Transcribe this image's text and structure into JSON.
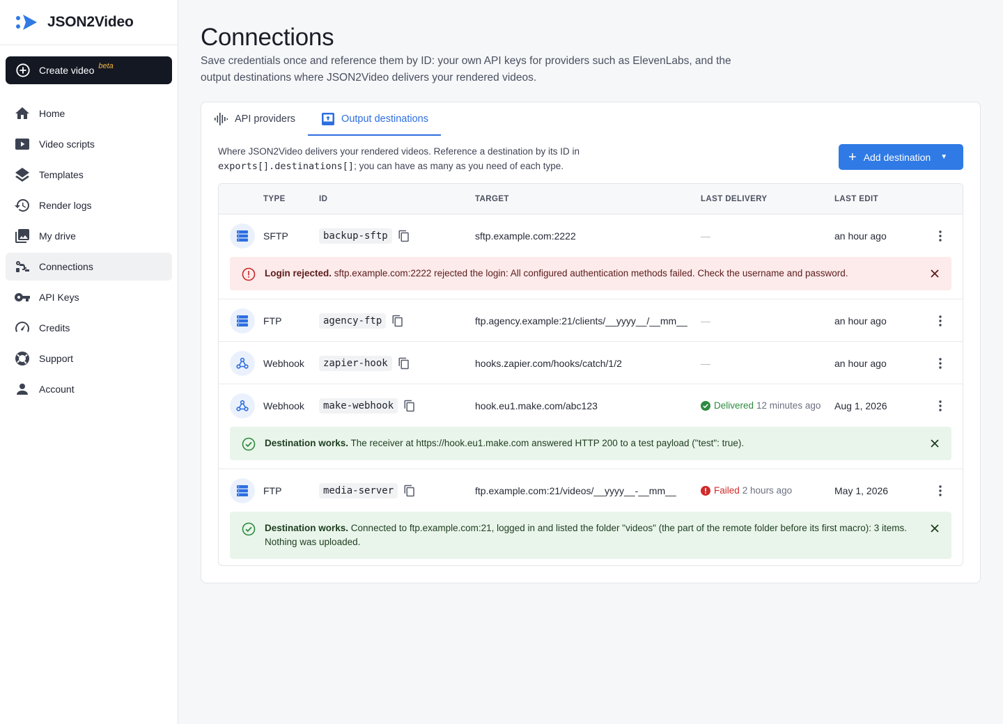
{
  "app": {
    "name": "JSON2Video"
  },
  "sidebar": {
    "create": {
      "label": "Create video",
      "badge": "beta"
    },
    "items": [
      {
        "label": "Home",
        "icon": "home-icon"
      },
      {
        "label": "Video scripts",
        "icon": "video-icon"
      },
      {
        "label": "Templates",
        "icon": "layers-icon"
      },
      {
        "label": "Render logs",
        "icon": "history-icon"
      },
      {
        "label": "My drive",
        "icon": "photo-library-icon"
      },
      {
        "label": "Connections",
        "icon": "connections-icon",
        "active": true
      },
      {
        "label": "API Keys",
        "icon": "key-icon"
      },
      {
        "label": "Credits",
        "icon": "gauge-icon"
      },
      {
        "label": "Support",
        "icon": "lifebuoy-icon"
      },
      {
        "label": "Account",
        "icon": "person-icon"
      }
    ]
  },
  "page": {
    "title": "Connections",
    "description": "Save credentials once and reference them by ID: your own API keys for providers such as ElevenLabs, and the output destinations where JSON2Video delivers your rendered videos."
  },
  "tabs": [
    {
      "label": "API providers",
      "active": false
    },
    {
      "label": "Output destinations",
      "active": true
    }
  ],
  "intro": {
    "text1": "Where JSON2Video delivers your rendered videos. Reference a destination by its ID in",
    "code": "exports[].destinations[]",
    "text2": "; you can have as many as you need of each type."
  },
  "add_button": {
    "label": "Add destination"
  },
  "table": {
    "columns": [
      "TYPE",
      "ID",
      "TARGET",
      "LAST DELIVERY",
      "LAST EDIT"
    ],
    "rows": [
      {
        "type": "SFTP",
        "icon": "server-icon",
        "id": "backup-sftp",
        "target": "sftp.example.com:2222",
        "delivery": "—",
        "edit": "an hour ago",
        "alert": {
          "kind": "error",
          "title": "Login rejected.",
          "text": "sftp.example.com:2222 rejected the login: All configured authentication methods failed. Check the username and password."
        }
      },
      {
        "type": "FTP",
        "icon": "server-icon",
        "id": "agency-ftp",
        "target": "ftp.agency.example:21/clients/__yyyy__/__mm__",
        "delivery": "—",
        "edit": "an hour ago"
      },
      {
        "type": "Webhook",
        "icon": "webhook-icon",
        "id": "zapier-hook",
        "target": "hooks.zapier.com/hooks/catch/1/2",
        "delivery": "—",
        "edit": "an hour ago"
      },
      {
        "type": "Webhook",
        "icon": "webhook-icon",
        "id": "make-webhook",
        "target": "hook.eu1.make.com/abc123",
        "delivery_status": "Delivered",
        "delivery_when": "12 minutes ago",
        "edit": "Aug 1, 2026",
        "alert": {
          "kind": "success",
          "title": "Destination works.",
          "text": "The receiver at https://hook.eu1.make.com answered HTTP 200 to a test payload (\"test\": true)."
        }
      },
      {
        "type": "FTP",
        "icon": "server-icon",
        "id": "media-server",
        "target": "ftp.example.com:21/videos/__yyyy__-__mm__",
        "delivery_status": "Failed",
        "delivery_when": "2 hours ago",
        "edit": "May 1, 2026",
        "alert": {
          "kind": "success",
          "title": "Destination works.",
          "text": "Connected to ftp.example.com:21, logged in and listed the folder \"videos\" (the part of the remote folder before its first macro): 3 items. Nothing was uploaded."
        }
      }
    ]
  },
  "colors": {
    "accent": "#2f7ae5",
    "success": "#2e8a3f",
    "error": "#d02b2b",
    "dark": "#141823"
  }
}
